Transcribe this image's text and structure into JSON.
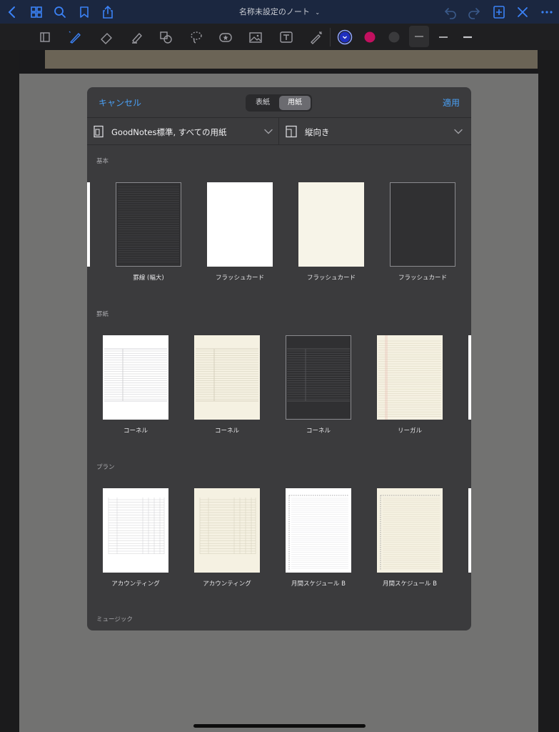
{
  "nav": {
    "title": "名称未設定のノート",
    "icons": [
      "back-icon",
      "grid-icon",
      "search-icon",
      "bookmark-icon",
      "share-icon",
      "undo-icon",
      "redo-icon",
      "add-page-icon",
      "close-icon",
      "more-icon"
    ]
  },
  "toolbar": {
    "tools": [
      "page-switch-icon",
      "pen-icon",
      "eraser-icon",
      "highlighter-icon",
      "shapes-icon",
      "lasso-icon",
      "sticker-icon",
      "image-icon",
      "text-box-icon",
      "laser-pointer-icon"
    ],
    "colors": [
      "#1f2fbf",
      "#c2105f",
      "#3a3a3c"
    ]
  },
  "dialog": {
    "cancel": "キャンセル",
    "apply": "適用",
    "tabs": [
      "表紙",
      "用紙"
    ],
    "active_tab": "用紙",
    "template_filter": "GoodNotes標準, すべての用紙",
    "orientation": "縦向き",
    "accent_color": "#4aa0f5",
    "sections": [
      {
        "title": "基本",
        "items": [
          {
            "label": "罫線 (幅大)",
            "style": "dark-lined"
          },
          {
            "label": "フラッシュカード",
            "style": "white-blank"
          },
          {
            "label": "フラッシュカード",
            "style": "cream-blank"
          },
          {
            "label": "フラッシュカード",
            "style": "dark-blank"
          }
        ]
      },
      {
        "title": "罫紙",
        "items": [
          {
            "label": "コーネル",
            "style": "white-cornell"
          },
          {
            "label": "コーネル",
            "style": "cream-cornell"
          },
          {
            "label": "コーネル",
            "style": "dark-cornell"
          },
          {
            "label": "リーガル",
            "style": "cream-legal"
          }
        ]
      },
      {
        "title": "プラン",
        "items": [
          {
            "label": "アカウンティング",
            "style": "white-accounting"
          },
          {
            "label": "アカウンティング",
            "style": "cream-accounting"
          },
          {
            "label": "月間スケジュール B",
            "style": "white-schedule"
          },
          {
            "label": "月間スケジュール B",
            "style": "cream-schedule"
          }
        ]
      },
      {
        "title": "ミュージック",
        "items": []
      }
    ]
  }
}
